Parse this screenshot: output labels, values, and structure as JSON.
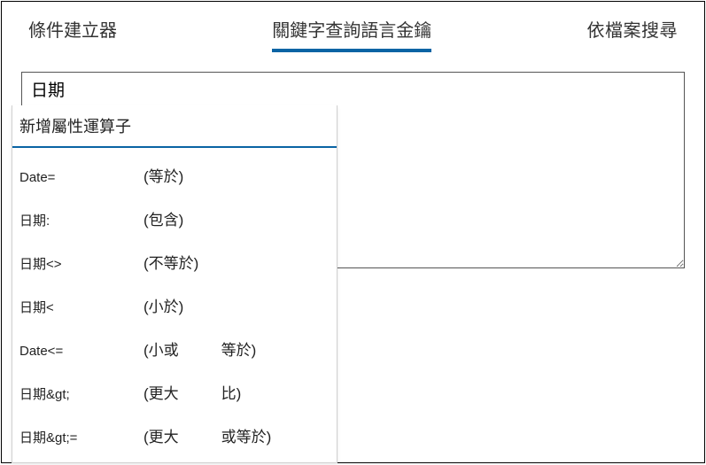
{
  "tabs": {
    "builder": "條件建立器",
    "kql": "關鍵字查詢語言金鑰",
    "byfile": "依檔案搜尋"
  },
  "query": {
    "value": "日期"
  },
  "dropdown": {
    "header": "新增屬性運算子",
    "items": [
      {
        "code": "Date=",
        "desc_a": "(等於)",
        "desc_b": ""
      },
      {
        "code": "日期:",
        "desc_a": "(包含)",
        "desc_b": ""
      },
      {
        "code": "日期<>",
        "desc_a": "(不等於)",
        "desc_b": ""
      },
      {
        "code": "日期<",
        "desc_a": "(小於)",
        "desc_b": ""
      },
      {
        "code": "Date<=",
        "desc_a": "(小或",
        "desc_b": "等於)"
      },
      {
        "code": "日期&gt;",
        "desc_a": "(更大",
        "desc_b": "比)"
      },
      {
        "code": "日期&gt;=",
        "desc_a": "(更大",
        "desc_b": "或等於)"
      }
    ]
  }
}
